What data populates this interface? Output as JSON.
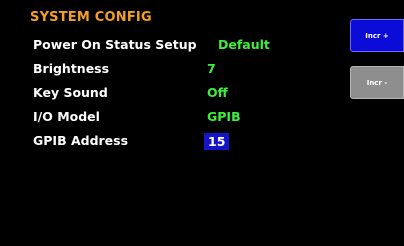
{
  "screen": {
    "title": "SYSTEM CONFIG"
  },
  "settings": [
    {
      "label": "Power On Status Setup",
      "value": "Default"
    },
    {
      "label": "Brightness",
      "value": "7"
    },
    {
      "label": "Key Sound",
      "value": "Off"
    },
    {
      "label": "I/O Model",
      "value": "GPIB"
    },
    {
      "label": "GPIB Address",
      "value": "15"
    }
  ],
  "softkeys": {
    "incr_plus": "Incr +",
    "incr_minus": "Incr -"
  },
  "colors": {
    "title": "#f5a020",
    "label": "#ffffff",
    "value": "#3cf03c",
    "selected_bg": "#1414c8",
    "softkey_active": "#0c0cd8",
    "softkey_inactive": "#8e8e8e"
  }
}
